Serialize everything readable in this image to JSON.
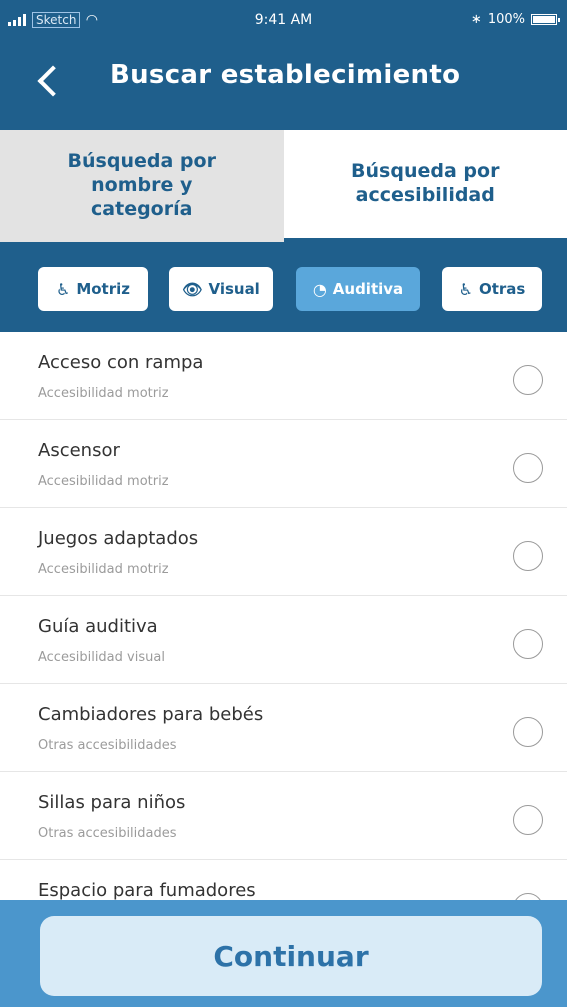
{
  "status_bar": {
    "carrier": "Sketch",
    "time": "9:41 AM",
    "battery": "100%"
  },
  "header": {
    "title": "Buscar establecimiento"
  },
  "tabs": [
    {
      "label_lines": [
        "Búsqueda por",
        "nombre y",
        "categoría"
      ]
    },
    {
      "label_lines": [
        "Búsqueda por",
        "accesibilidad"
      ]
    }
  ],
  "filters": [
    {
      "label": "Motriz",
      "icon": "wheelchair-icon",
      "active": false
    },
    {
      "label": "Visual",
      "icon": "eye-slash-icon",
      "active": false
    },
    {
      "label": "Auditiva",
      "icon": "ear-icon",
      "active": true
    },
    {
      "label": "Otras",
      "icon": "wheelchair-icon",
      "active": false
    }
  ],
  "items": [
    {
      "title": "Acceso con rampa",
      "subtitle": "Accesibilidad motriz"
    },
    {
      "title": "Ascensor",
      "subtitle": "Accesibilidad motriz"
    },
    {
      "title": "Juegos adaptados",
      "subtitle": "Accesibilidad motriz"
    },
    {
      "title": "Guía auditiva",
      "subtitle": "Accesibilidad visual"
    },
    {
      "title": "Cambiadores para bebés",
      "subtitle": "Otras accesibilidades"
    },
    {
      "title": "Sillas para niños",
      "subtitle": "Otras accesibilidades"
    },
    {
      "title": "Espacio para fumadores",
      "subtitle": ""
    }
  ],
  "footer": {
    "continue_label": "Continuar"
  },
  "colors": {
    "primary": "#1f5f8c",
    "active_chip": "#5aa7db",
    "footer": "#4b96cc",
    "button": "#d9ebf7"
  }
}
